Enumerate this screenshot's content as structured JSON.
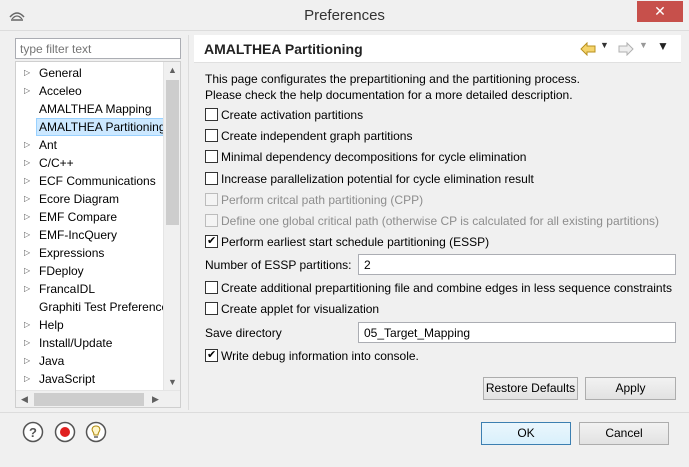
{
  "window": {
    "title": "Preferences",
    "close_glyph": "✕"
  },
  "filter": {
    "placeholder": "type filter text"
  },
  "tree": {
    "items": [
      {
        "label": "General",
        "expandable": true
      },
      {
        "label": "Acceleo",
        "expandable": true
      },
      {
        "label": "AMALTHEA Mapping",
        "expandable": false
      },
      {
        "label": "AMALTHEA Partitioning",
        "expandable": false,
        "selected": true
      },
      {
        "label": "Ant",
        "expandable": true
      },
      {
        "label": "C/C++",
        "expandable": true
      },
      {
        "label": "ECF Communications",
        "expandable": true
      },
      {
        "label": "Ecore Diagram",
        "expandable": true
      },
      {
        "label": "EMF Compare",
        "expandable": true
      },
      {
        "label": "EMF-IncQuery",
        "expandable": true
      },
      {
        "label": "Expressions",
        "expandable": true
      },
      {
        "label": "FDeploy",
        "expandable": true
      },
      {
        "label": "FrancaIDL",
        "expandable": true
      },
      {
        "label": "Graphiti Test Preference",
        "expandable": false
      },
      {
        "label": "Help",
        "expandable": true
      },
      {
        "label": "Install/Update",
        "expandable": true
      },
      {
        "label": "Java",
        "expandable": true
      },
      {
        "label": "JavaScript",
        "expandable": true
      }
    ]
  },
  "page": {
    "title": "AMALTHEA Partitioning",
    "description_line1": "This page configurates the prepartitioning and the partitioning process.",
    "description_line2": "Please check the help documentation for a more detailed description.",
    "options": [
      {
        "label": "Create activation partitions",
        "checked": false,
        "disabled": false
      },
      {
        "label": "Create independent graph partitions",
        "checked": false,
        "disabled": false
      },
      {
        "label": "Minimal dependency decompositions for cycle elimination",
        "checked": false,
        "disabled": false
      },
      {
        "label": "Increase parallelization potential for cycle elimination result",
        "checked": false,
        "disabled": false
      },
      {
        "label": "Perform critcal path partitioning (CPP)",
        "checked": false,
        "disabled": true
      },
      {
        "label": "Define one global critical path (otherwise CP is calculated for all existing partitions)",
        "checked": false,
        "disabled": true
      },
      {
        "label": "Perform earliest start schedule partitioning (ESSP)",
        "checked": true,
        "disabled": false
      }
    ],
    "essp_label": "Number of ESSP partitions:",
    "essp_value": "2",
    "options2": [
      {
        "label": "Create additional prepartitioning file and combine edges in less sequence constraints",
        "checked": false
      },
      {
        "label": "Create applet for visualization",
        "checked": false
      }
    ],
    "save_dir_label": "Save directory",
    "save_dir_value": "05_Target_Mapping",
    "debug_label": "Write debug information into console.",
    "debug_checked": true,
    "restore_defaults": "Restore Defaults",
    "apply": "Apply"
  },
  "footer": {
    "icons": [
      "help-icon",
      "record-icon",
      "lightbulb-icon"
    ],
    "ok": "OK",
    "cancel": "Cancel"
  }
}
